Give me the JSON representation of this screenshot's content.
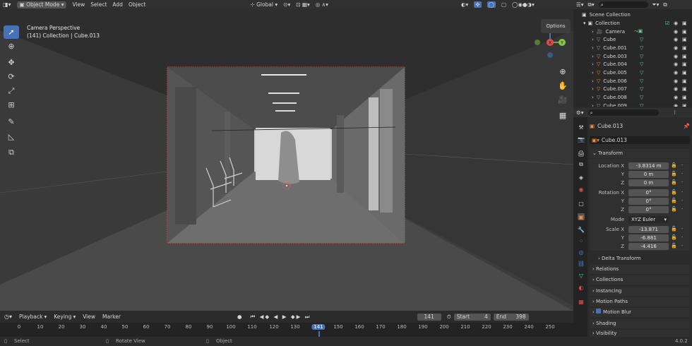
{
  "header": {
    "editor_icon": "viewport-icon",
    "mode": "Object Mode",
    "menus": [
      "View",
      "Select",
      "Add",
      "Object"
    ],
    "transform_orientation": "Global",
    "options_label": "Options"
  },
  "viewport": {
    "info_line1": "Camera Perspective",
    "info_line2": "(141) Collection | Cube.013"
  },
  "timeline": {
    "menus": [
      "Playback",
      "Keying",
      "View",
      "Marker"
    ],
    "current_frame": "141",
    "start_label": "Start",
    "start_value": "4",
    "end_label": "End",
    "end_value": "398",
    "ticks": [
      "0",
      "10",
      "20",
      "30",
      "40",
      "50",
      "60",
      "70",
      "80",
      "90",
      "100",
      "110",
      "120",
      "130",
      "141",
      "150",
      "160",
      "170",
      "180",
      "190",
      "200",
      "210",
      "220",
      "230",
      "240",
      "250"
    ]
  },
  "statusbar": {
    "select": "Select",
    "rotate": "Rotate View",
    "object": "Object",
    "version": "4.0.2"
  },
  "outliner": {
    "scene_collection": "Scene Collection",
    "collection": "Collection",
    "items": [
      "Camera",
      "Cube",
      "Cube.001",
      "Cube.003",
      "Cube.004",
      "Cube.005",
      "Cube.006",
      "Cube.007",
      "Cube.008",
      "Cube.009"
    ]
  },
  "properties": {
    "object_name": "Cube.013",
    "data_name": "Cube.013",
    "transform_label": "Transform",
    "location_label": "Location X",
    "location": [
      "-3.8314 m",
      "0 m",
      "0 m"
    ],
    "rotation_label": "Rotation X",
    "rotation": [
      "0°",
      "0°",
      "0°"
    ],
    "mode_label": "Mode",
    "mode_value": "XYZ Euler",
    "scale_label": "Scale X",
    "scale": [
      "-13.871",
      "-6.881",
      "-4.416"
    ],
    "axis_y": "Y",
    "axis_z": "Z",
    "panels": [
      "Delta Transform",
      "Relations",
      "Collections",
      "Instancing",
      "Motion Paths",
      "Motion Blur",
      "Shading",
      "Visibility"
    ]
  },
  "colors": {
    "accent": "#4772b3",
    "object_orange": "#f0903c",
    "mesh_green": "#6ad0a0",
    "axis_x": "#e04c4c",
    "axis_y": "#86c44c",
    "axis_z": "#4c8ce0",
    "playhead": "#4772b3"
  }
}
